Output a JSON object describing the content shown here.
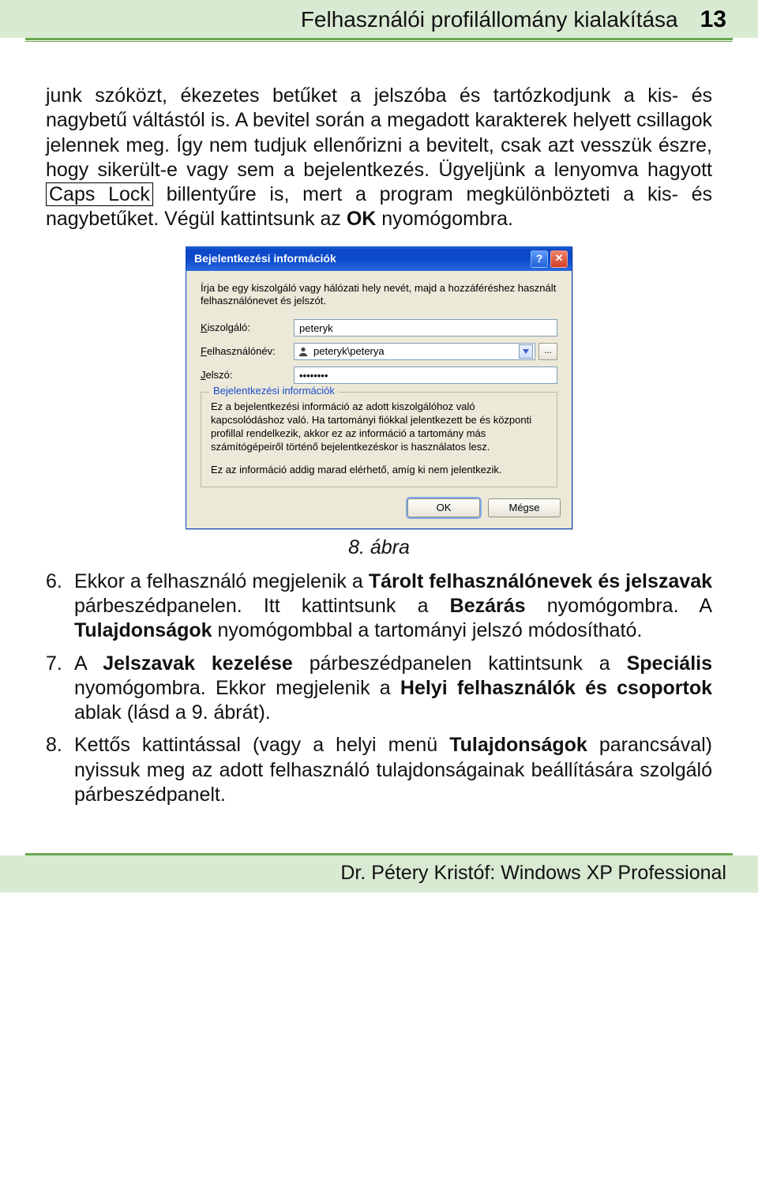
{
  "header": {
    "title": "Felhasználói profilállomány kialakítása",
    "page_number": "13"
  },
  "body": {
    "intro_part1": "junk szóközt, ékezetes betűket a jelszóba és tartózkodjunk a kis- és nagybetű váltástól is. A bevitel során a megadott karakterek helyett csillagok jelennek meg. Így nem tudjuk ellenőrizni a bevitelt, csak azt vesszük észre, hogy sikerült-e vagy sem a bejelentkezés. Ügyeljünk a lenyomva hagyott ",
    "capslock": "Caps Lock",
    "intro_part2": " billentyűre is, mert a program megkülönbözteti a kis- és nagybetűket. Végül kattintsunk az ",
    "ok_word": "OK",
    "intro_part3": " nyomógombra.",
    "caption": "8. ábra",
    "items": [
      {
        "num": "6.",
        "html": [
          {
            "t": "Ekkor a felhasználó megjelenik a "
          },
          {
            "b": "Tárolt felhasználónevek és jelszavak"
          },
          {
            "t": " párbeszédpanelen. Itt kattintsunk a "
          },
          {
            "b": "Bezárás"
          },
          {
            "t": " nyomógombra. A "
          },
          {
            "b": "Tulajdonságok"
          },
          {
            "t": " nyomógombbal a tartományi jelszó módosítható."
          }
        ]
      },
      {
        "num": "7.",
        "html": [
          {
            "t": "A "
          },
          {
            "b": "Jelszavak kezelése"
          },
          {
            "t": " párbeszédpanelen kattintsunk a "
          },
          {
            "b": "Speciális"
          },
          {
            "t": " nyomógombra. Ekkor megjelenik a "
          },
          {
            "b": "Helyi felhasználók és csoportok"
          },
          {
            "t": " ablak (lásd a 9. ábrát)."
          }
        ]
      },
      {
        "num": "8.",
        "html": [
          {
            "t": "Kettős kattintással (vagy a helyi menü "
          },
          {
            "b": "Tulajdonságok"
          },
          {
            "t": " parancsával) nyissuk meg az adott felhasználó tulajdonságainak beállítására szolgáló párbeszédpanelt."
          }
        ]
      }
    ]
  },
  "dialog": {
    "title": "Bejelentkezési információk",
    "instruction": "Írja be egy kiszolgáló vagy hálózati hely nevét, majd a hozzáféréshez használt felhasználónevet és jelszót.",
    "server_label": "Kiszolgáló:",
    "server_underline": "K",
    "server_value": "peteryk",
    "user_label": "Felhasználónév:",
    "user_underline": "F",
    "user_value": "peteryk\\peterya",
    "dots": "...",
    "password_label": "Jelszó:",
    "password_underline": "J",
    "password_value": "••••••••",
    "group_legend": "Bejelentkezési információk",
    "group_p1": "Ez a bejelentkezési információ az adott kiszolgálóhoz való kapcsolódáshoz való. Ha tartományi fiókkal jelentkezett be és központi profillal rendelkezik, akkor ez az információ a tartomány más számítógépeiről történő bejelentkezéskor is használatos lesz.",
    "group_p2": "Ez az információ addig marad elérhető, amíg ki nem jelentkezik.",
    "ok": "OK",
    "cancel": "Mégse"
  },
  "footer": {
    "text": "Dr. Pétery Kristóf: Windows XP Professional"
  }
}
